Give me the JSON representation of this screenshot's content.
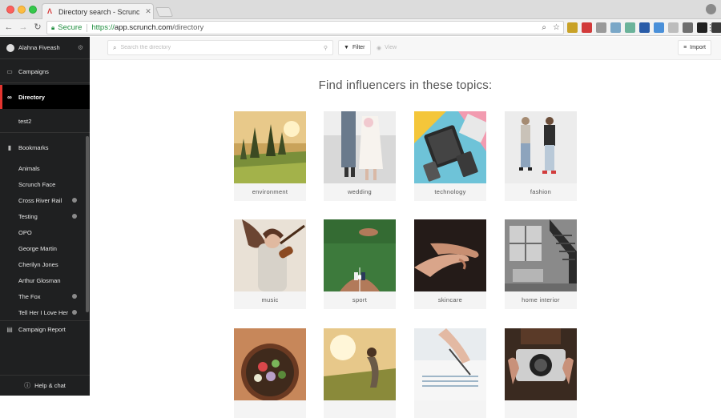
{
  "browser": {
    "tab_title": "Directory search - Scrunch",
    "secure_label": "Secure",
    "url_scheme": "https://",
    "url_host": "app.scrunch.com",
    "url_path": "/directory"
  },
  "sidebar": {
    "user_name": "Alahna Fiveash",
    "campaigns": "Campaigns",
    "directory": "Directory",
    "test2": "test2",
    "bookmarks": "Bookmarks",
    "bookmark_items": [
      {
        "label": "Animals",
        "badge": false
      },
      {
        "label": "Scrunch Face",
        "badge": false
      },
      {
        "label": "Cross River Rail",
        "badge": true
      },
      {
        "label": "Testing",
        "badge": true
      },
      {
        "label": "OPO",
        "badge": false
      },
      {
        "label": "George Martin",
        "badge": false
      },
      {
        "label": "Cherilyn Jones",
        "badge": false
      },
      {
        "label": "Arthur Glosman",
        "badge": false
      },
      {
        "label": "The Fox",
        "badge": true
      },
      {
        "label": "Tell Her I Love Her",
        "badge": true
      }
    ],
    "campaign_report": "Campaign Report",
    "help": "Help & chat"
  },
  "topbar": {
    "search_placeholder": "Search the directory",
    "filter_label": "Filter",
    "view_label": "View",
    "import_label": "Import"
  },
  "main": {
    "heading": "Find influencers in these topics:",
    "topics": [
      {
        "label": "environment"
      },
      {
        "label": "wedding"
      },
      {
        "label": "technology"
      },
      {
        "label": "fashion"
      },
      {
        "label": "music"
      },
      {
        "label": "sport"
      },
      {
        "label": "skincare"
      },
      {
        "label": "home interior"
      },
      {
        "label": ""
      },
      {
        "label": ""
      },
      {
        "label": ""
      },
      {
        "label": ""
      }
    ]
  },
  "colors": {
    "accent": "#e3342f",
    "sidebar_bg": "#1f2021"
  }
}
